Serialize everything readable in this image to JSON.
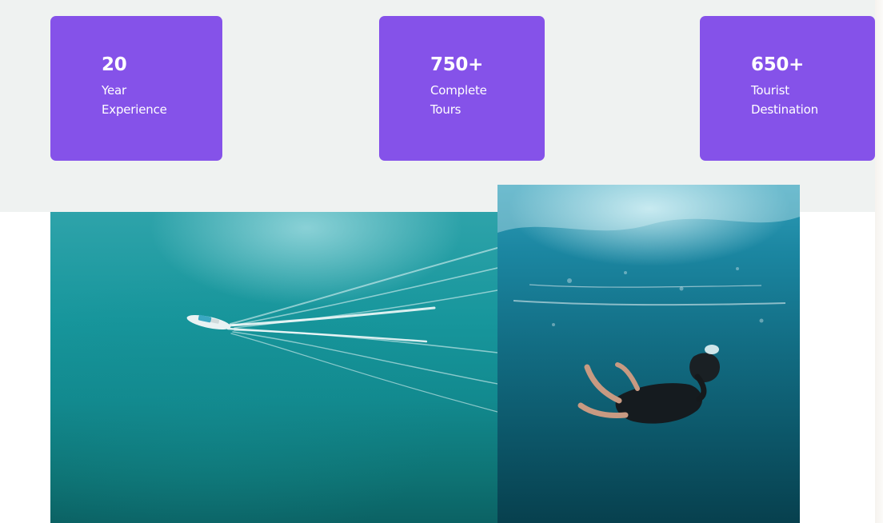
{
  "stats": [
    {
      "number": "20",
      "label": "Year Experience"
    },
    {
      "number": "750+",
      "label": "Complete Tours"
    },
    {
      "number": "650+",
      "label": "Tourist Destination"
    }
  ],
  "colors": {
    "card_background": "#8552e9",
    "band_background": "#eff2f1",
    "card_text": "#ffffff"
  },
  "images": [
    {
      "name": "aerial-boat-photo"
    },
    {
      "name": "underwater-diver-photo"
    }
  ]
}
